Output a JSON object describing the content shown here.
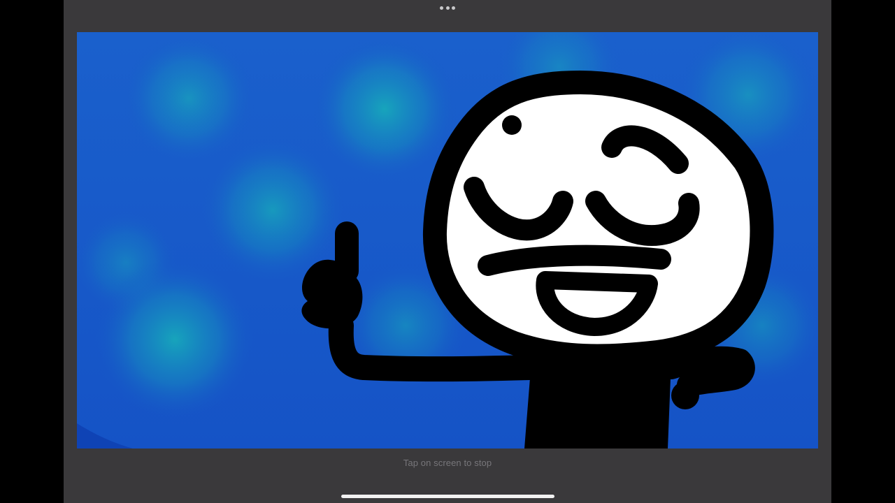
{
  "hint": {
    "stop_text": "Tap on screen to stop"
  },
  "icons": {
    "multitasking": "more-dots-icon",
    "home": "home-indicator"
  },
  "colors": {
    "device_bezel": "#3a393b",
    "canvas_blue": "#1758c9",
    "canvas_glow": "#17a8bb",
    "ink": "#000000",
    "face": "#ffffff",
    "hint_text": "#77767a",
    "home_indicator": "#f2f2f2"
  }
}
